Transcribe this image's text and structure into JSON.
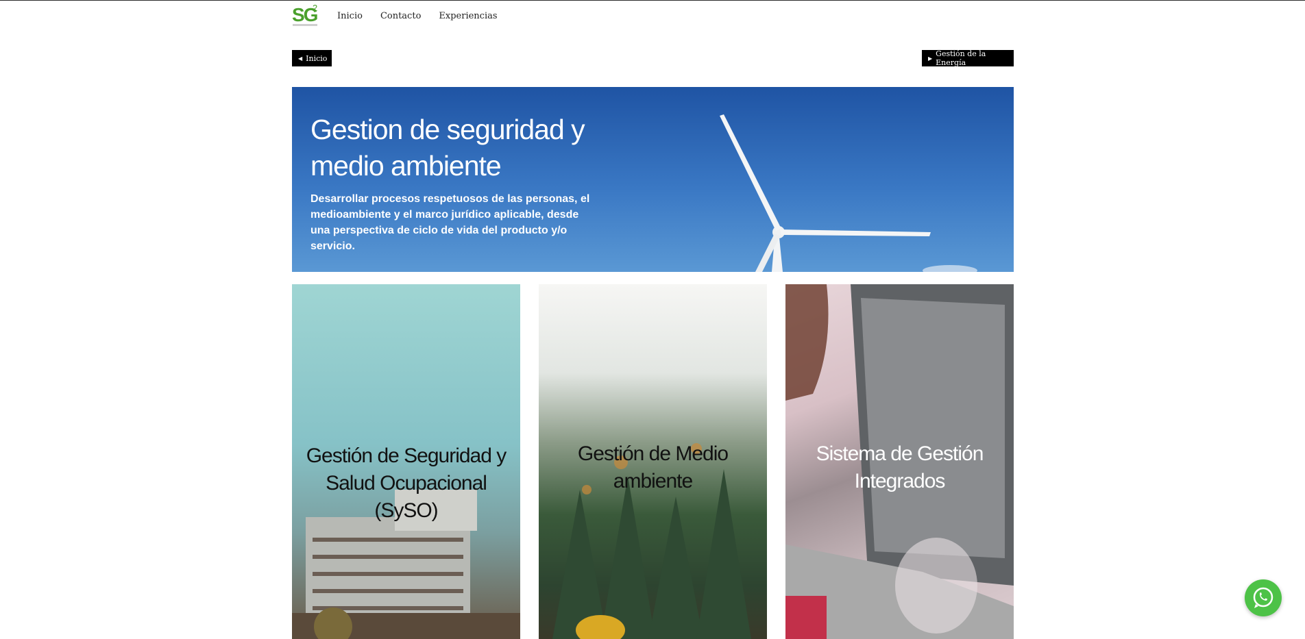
{
  "header": {
    "logo": {
      "text": "SG",
      "superscript": "2"
    },
    "nav": [
      {
        "label": "Inicio"
      },
      {
        "label": "Contacto"
      },
      {
        "label": "Experiencias"
      }
    ]
  },
  "pager": {
    "prev_label": "Inicio",
    "next_label": "Gestión de la Energía"
  },
  "hero": {
    "title": "Gestion de seguridad y medio ambiente",
    "description": "Desarrollar procesos respetuosos de las personas, el medioambiente y el marco jurídico aplicable, desde una perspectiva de ciclo de vida del producto y/o servicio."
  },
  "cards": [
    {
      "label": "Gestión de Seguridad y Salud Ocupacional (SySO)",
      "text_color": "#111111"
    },
    {
      "label": "Gestión de Medio ambiente",
      "text_color": "#111111"
    },
    {
      "label": "Sistema de Gestión Integrados",
      "text_color": "#ffffff"
    }
  ],
  "colors": {
    "brand_green": "#4aa02c",
    "pill_bg": "#000000",
    "hero_blue": "#2f68b6",
    "whatsapp_green": "#4dc247"
  },
  "icons": {
    "prev": "caret-left-icon",
    "next": "caret-right-icon",
    "chat": "whatsapp-icon"
  }
}
